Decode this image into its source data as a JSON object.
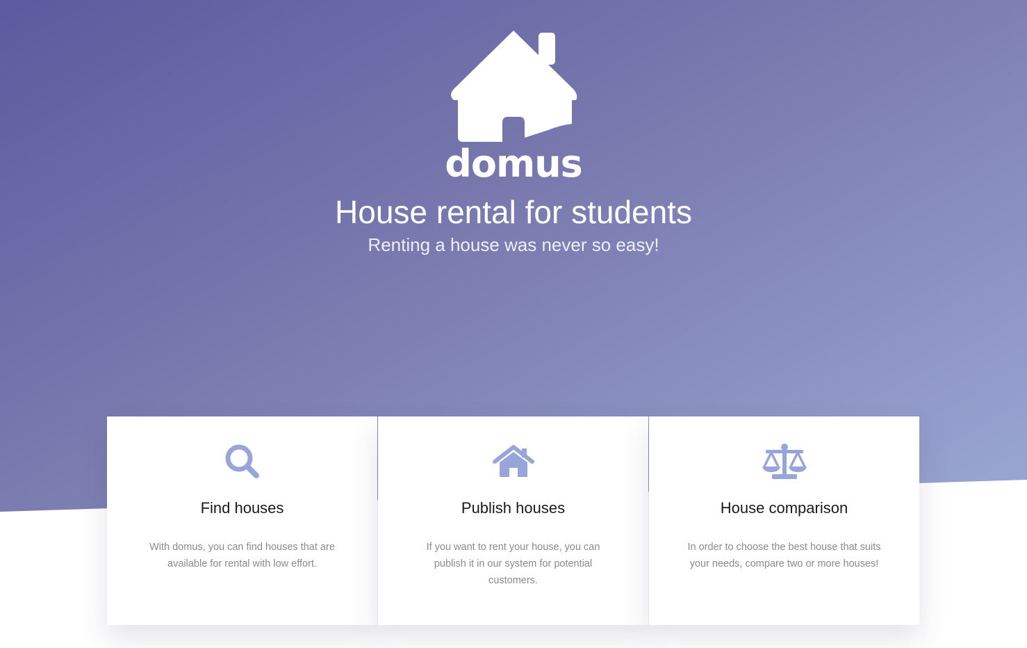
{
  "brand": {
    "name": "domus",
    "logo_icon": "house-logo-icon"
  },
  "hero": {
    "title": "House rental for students",
    "subtitle": "Renting a house was never so easy!"
  },
  "colors": {
    "gradient_start": "#5d599f",
    "gradient_end": "#96a1ce",
    "icon_color": "#98a5da",
    "card_background": "#ffffff"
  },
  "features": [
    {
      "icon": "search-icon",
      "title": "Find houses",
      "text": "With domus, you can find houses that are available for rental with low effort."
    },
    {
      "icon": "home-icon",
      "title": "Publish houses",
      "text": "If you want to rent your house, you can publish it in our system for potential customers."
    },
    {
      "icon": "balance-scale-icon",
      "title": "House comparison",
      "text": "In order to choose the best house that suits your needs, compare two or more houses!"
    }
  ]
}
